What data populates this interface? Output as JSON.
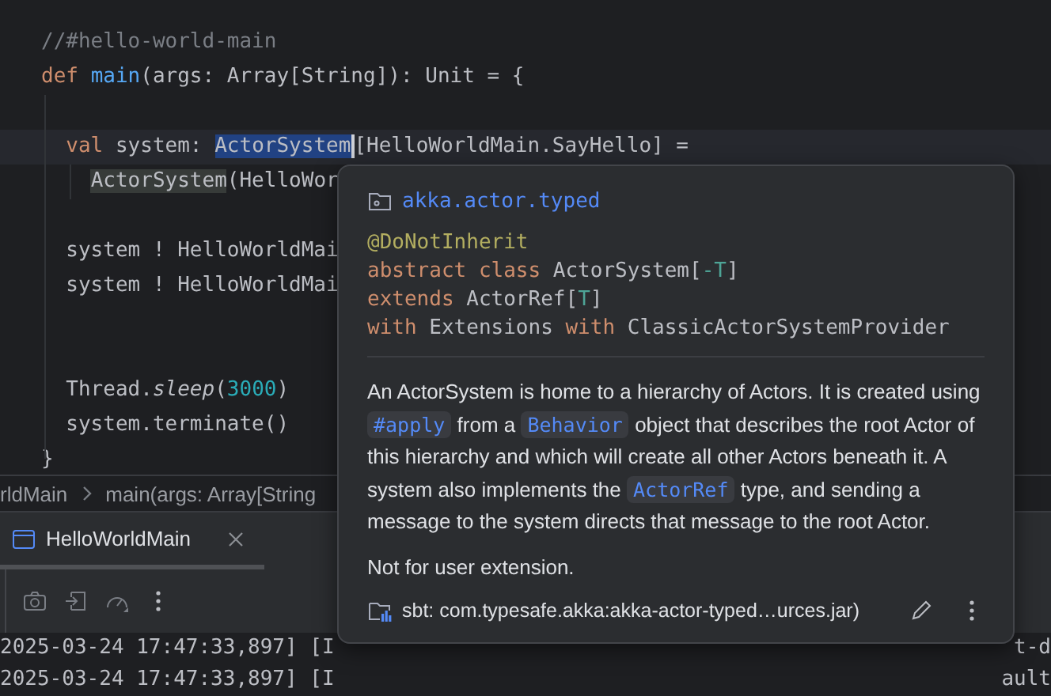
{
  "editor": {
    "lines": [
      {
        "kind": "code",
        "current": false,
        "tokens": [
          {
            "text": "//#hello-world-main",
            "kind": "comment"
          }
        ]
      },
      {
        "kind": "code",
        "current": false,
        "tokens": [
          {
            "text": "def ",
            "kind": "keyword"
          },
          {
            "text": "main",
            "kind": "function"
          },
          {
            "text": "(args: Array[String]): Unit = {",
            "kind": "plain"
          }
        ]
      },
      {
        "kind": "blank"
      },
      {
        "kind": "code",
        "current": true,
        "tokens": [
          {
            "text": "  val ",
            "kind": "keyword"
          },
          {
            "text": "system: ",
            "kind": "plain"
          },
          {
            "text": "ActorSystem",
            "kind": "selected"
          },
          {
            "text": "[HelloWorldMain.SayHello] =",
            "kind": "plain"
          }
        ]
      },
      {
        "kind": "code",
        "current": false,
        "tokens": [
          {
            "text": "    ActorSystem",
            "kind": "usage"
          },
          {
            "text": "(HelloWor",
            "kind": "plain"
          }
        ]
      },
      {
        "kind": "blank"
      },
      {
        "kind": "code",
        "current": false,
        "tokens": [
          {
            "text": "  system ! HelloWorldMai",
            "kind": "plain"
          }
        ]
      },
      {
        "kind": "code",
        "current": false,
        "tokens": [
          {
            "text": "  system ! HelloWorldMai",
            "kind": "plain"
          }
        ]
      },
      {
        "kind": "blank"
      },
      {
        "kind": "blank"
      },
      {
        "kind": "code",
        "current": false,
        "tokens": [
          {
            "text": "  Thread.",
            "kind": "plain"
          },
          {
            "text": "sleep",
            "kind": "italic"
          },
          {
            "text": "(",
            "kind": "plain"
          },
          {
            "text": "3000",
            "kind": "number"
          },
          {
            "text": ")",
            "kind": "plain"
          }
        ]
      },
      {
        "kind": "code",
        "current": false,
        "tokens": [
          {
            "text": "  system.terminate()",
            "kind": "plain"
          }
        ]
      },
      {
        "kind": "code",
        "current": false,
        "tokens": [
          {
            "text": "}",
            "kind": "plain"
          }
        ]
      }
    ]
  },
  "breadcrumbs": [
    "rldMain",
    "main(args: Array[String"
  ],
  "tool_window": {
    "tab": {
      "label": "HelloWorldMain",
      "selected": true
    },
    "console_lines": [
      {
        "text": "2025-03-24 17:47:33,897] [I",
        "tail": "t-d"
      },
      {
        "text": "2025-03-24 17:47:33,897] [I",
        "tail": "ault"
      }
    ]
  },
  "popup": {
    "package": "akka.actor.typed",
    "signature": [
      [
        {
          "text": "@DoNotInherit",
          "kind": "annotation"
        }
      ],
      [
        {
          "text": "abstract class ",
          "kind": "keyword"
        },
        {
          "text": "ActorSystem[",
          "kind": "plain"
        },
        {
          "text": "-T",
          "kind": "typeparam"
        },
        {
          "text": "]",
          "kind": "plain"
        }
      ],
      [
        {
          "text": "extends ",
          "kind": "keyword"
        },
        {
          "text": "ActorRef[",
          "kind": "plain"
        },
        {
          "text": "T",
          "kind": "typeparam"
        },
        {
          "text": "]",
          "kind": "plain"
        }
      ],
      [
        {
          "text": "with ",
          "kind": "keyword"
        },
        {
          "text": "Extensions ",
          "kind": "plain"
        },
        {
          "text": "with ",
          "kind": "keyword"
        },
        {
          "text": "ClassicActorSystemProvider",
          "kind": "plain"
        }
      ]
    ],
    "description": [
      {
        "text": "An ActorSystem is home to a hierarchy of Actors. It is created using ",
        "kind": "text"
      },
      {
        "text": "#apply",
        "kind": "code"
      },
      {
        "text": " from a ",
        "kind": "text"
      },
      {
        "text": "Behavior",
        "kind": "code"
      },
      {
        "text": " object that describes the root Actor of this hierarchy and which will create all other Actors beneath it. A system also implements the ",
        "kind": "text"
      },
      {
        "text": "ActorRef",
        "kind": "code"
      },
      {
        "text": " type, and sending a message to the system directs that message to the root Actor.",
        "kind": "text"
      }
    ],
    "note": "Not for user extension.",
    "source": "sbt: com.typesafe.akka:akka-actor-typed…urces.jar)"
  }
}
